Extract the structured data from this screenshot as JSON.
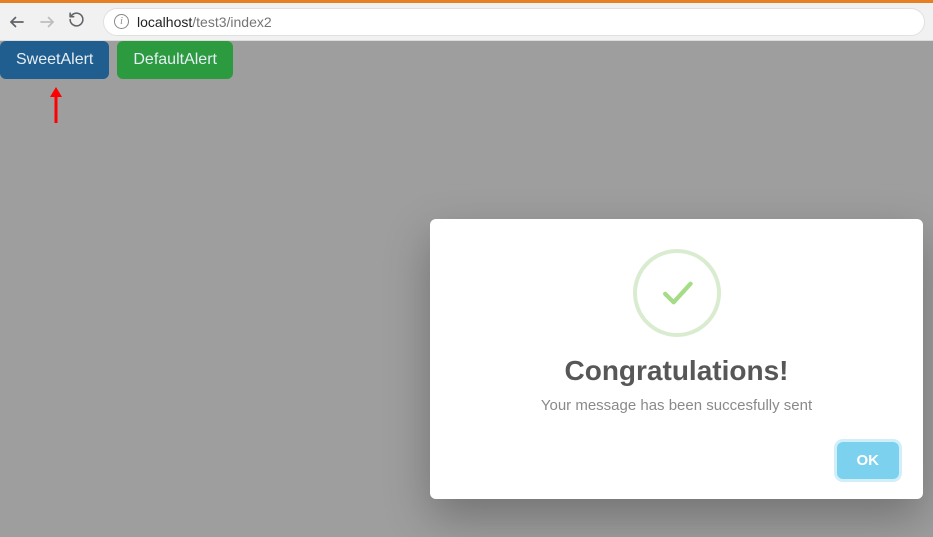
{
  "browser": {
    "url_host": "localhost",
    "url_path": "/test3/index2"
  },
  "buttons": {
    "sweet": "SweetAlert",
    "default": "DefaultAlert"
  },
  "modal": {
    "title": "Congratulations!",
    "message": "Your message has been succesfully sent",
    "ok_label": "OK"
  }
}
